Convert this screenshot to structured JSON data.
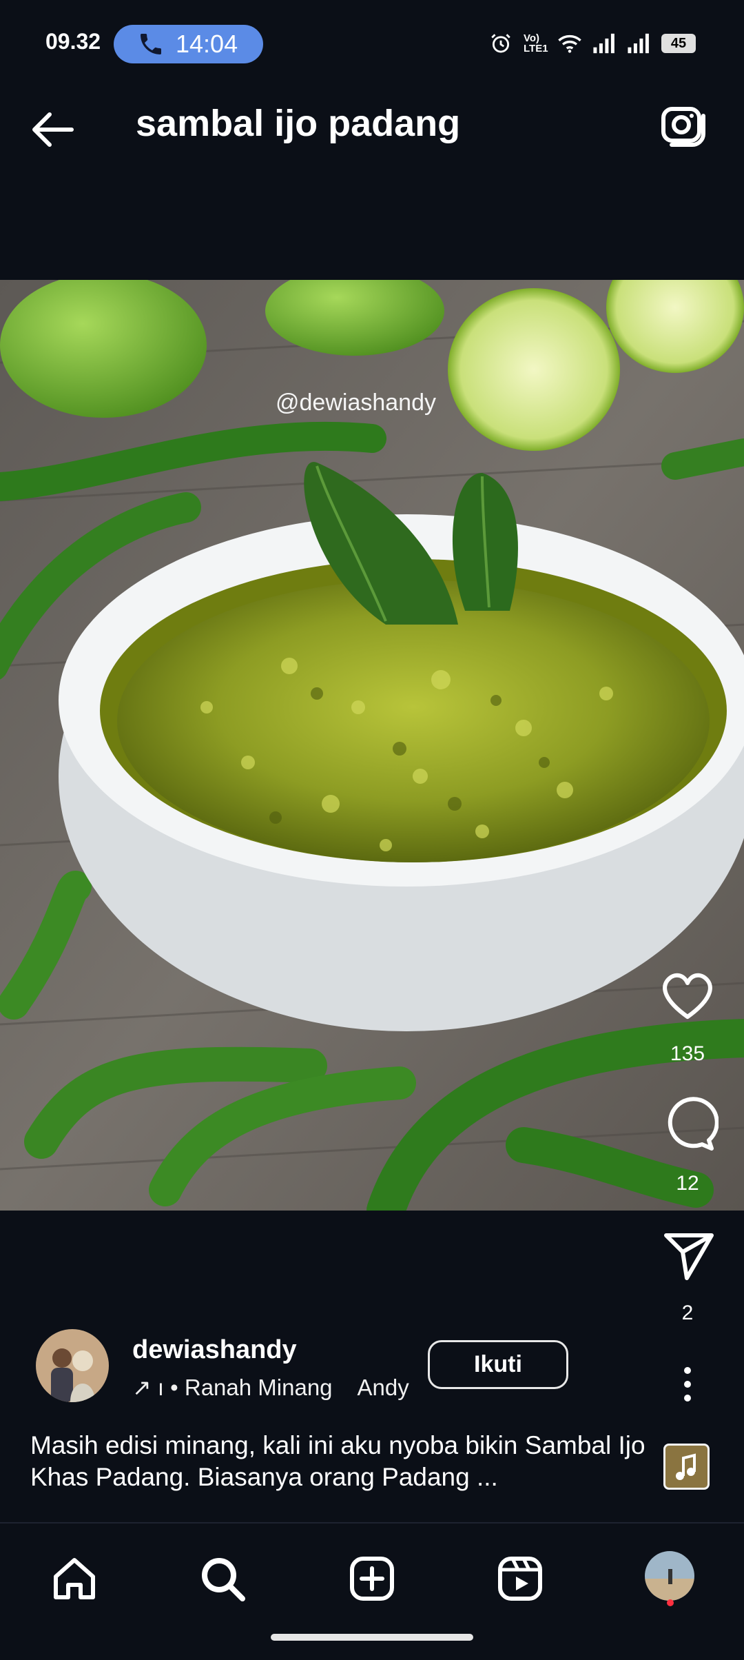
{
  "status_bar": {
    "time": "09.32",
    "call_time": "14:04",
    "volte": "Vo) LTE1",
    "battery": "45"
  },
  "header": {
    "title": "sambal ijo padang"
  },
  "post": {
    "watermark": "@dewiashandy",
    "likes": "135",
    "comments": "12",
    "shares": "2",
    "username": "dewiashandy",
    "audio_prefix": "↗ ı • Ranah Minang",
    "audio_artist": "Andy",
    "follow_label": "Ikuti",
    "caption": "Masih edisi minang, kali ini aku nyoba bikin Sambal Ijo Khas Padang. Biasanya orang Padang ..."
  },
  "icons": {
    "back": "back-arrow-icon",
    "camera": "camera-icon",
    "like": "heart-icon",
    "comment": "comment-icon",
    "share": "send-icon",
    "more": "more-vertical-icon",
    "nav": [
      "home-icon",
      "search-icon",
      "create-icon",
      "reels-icon",
      "profile-avatar"
    ]
  },
  "colors": {
    "background": "#0b0f17",
    "call_pill": "#5b8be6",
    "notification_dot": "#ff3040"
  }
}
